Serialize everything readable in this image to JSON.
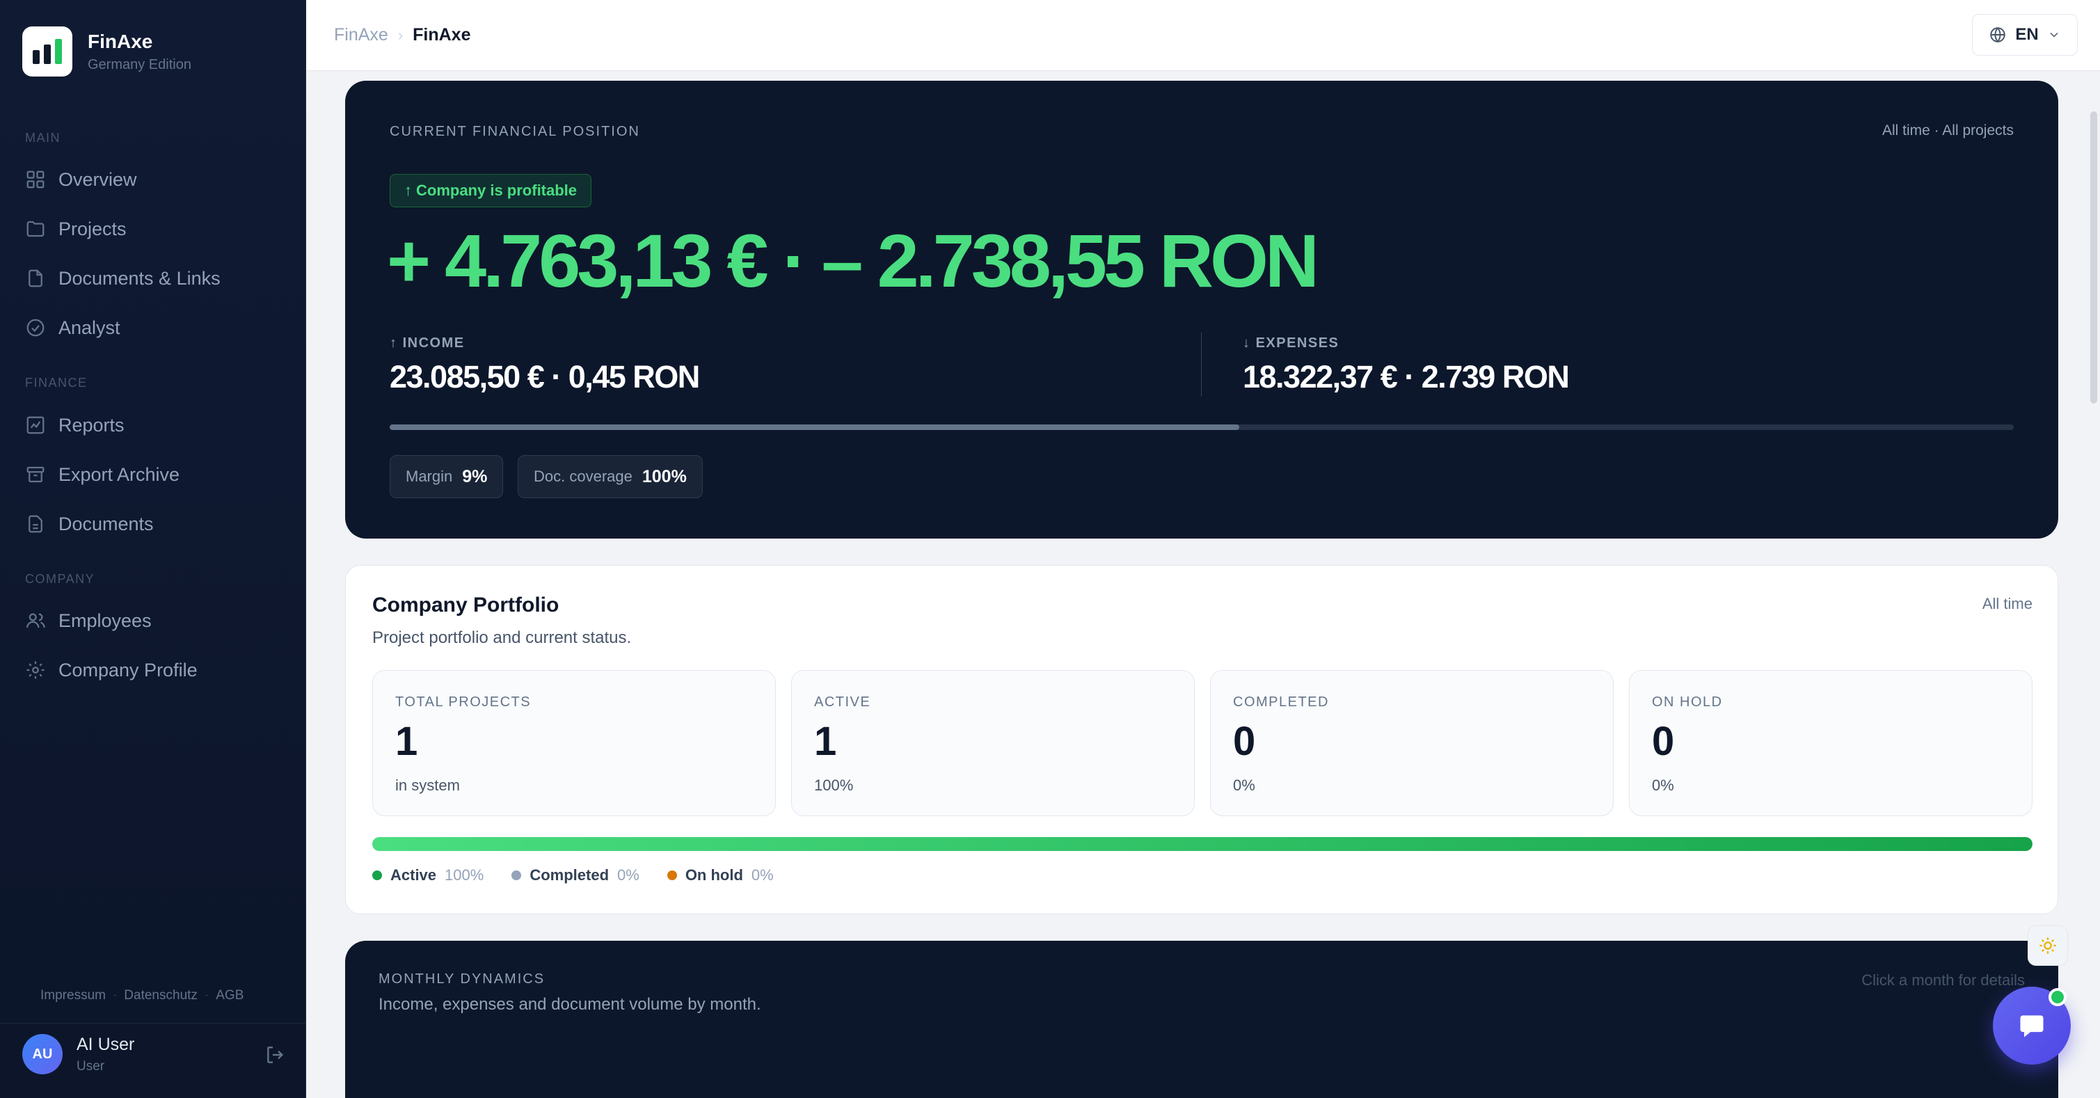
{
  "brand": {
    "name": "FinAxe",
    "edition": "Germany Edition",
    "logo_bar_colors": [
      "#0f172a",
      "#0f172a",
      "#22c55e"
    ]
  },
  "nav": {
    "main_label": "MAIN",
    "main_items": [
      {
        "label": "Overview",
        "icon": "grid-icon"
      },
      {
        "label": "Projects",
        "icon": "folder-icon"
      },
      {
        "label": "Documents & Links",
        "icon": "file-icon"
      },
      {
        "label": "Analyst",
        "icon": "check-circle-icon"
      }
    ],
    "finance_label": "FINANCE",
    "finance_items": [
      {
        "label": "Reports",
        "icon": "chart-icon"
      },
      {
        "label": "Export Archive",
        "icon": "archive-icon"
      },
      {
        "label": "Documents",
        "icon": "document-icon"
      }
    ],
    "company_label": "COMPANY",
    "company_items": [
      {
        "label": "Employees",
        "icon": "users-icon"
      },
      {
        "label": "Company Profile",
        "icon": "gear-icon"
      }
    ]
  },
  "footer": {
    "links": [
      "Impressum",
      "Datenschutz",
      "AGB"
    ]
  },
  "user": {
    "initials": "AU",
    "name": "AI User",
    "role": "User"
  },
  "topbar": {
    "breadcrumb_root": "FinAxe",
    "breadcrumb_current": "FinAxe",
    "language": "EN"
  },
  "financial": {
    "label": "CURRENT FINANCIAL POSITION",
    "scope": "All time · All projects",
    "badge": "Company is profitable",
    "big_value": "+ 4.763,13 € · – 2.738,55 RON",
    "income_label": "INCOME",
    "income_value": "23.085,50 € · 0,45 RON",
    "expenses_label": "EXPENSES",
    "expenses_value": "18.322,37 € · 2.739 RON",
    "income_share": 0.523,
    "margin_label": "Margin",
    "margin_value": "9%",
    "coverage_label": "Doc. coverage",
    "coverage_value": "100%",
    "accent": "#4ade80"
  },
  "portfolio": {
    "title": "Company Portfolio",
    "subtitle": "Project portfolio and current status.",
    "scope": "All time",
    "stats": [
      {
        "label": "TOTAL PROJECTS",
        "value": "1",
        "note": "in system"
      },
      {
        "label": "ACTIVE",
        "value": "1",
        "note": "100%"
      },
      {
        "label": "COMPLETED",
        "value": "0",
        "note": "0%"
      },
      {
        "label": "ON HOLD",
        "value": "0",
        "note": "0%"
      }
    ],
    "active_share": 1.0,
    "legend": [
      {
        "name": "Active",
        "pct": "100%",
        "color": "#16a34a"
      },
      {
        "name": "Completed",
        "pct": "0%",
        "color": "#94a3b8"
      },
      {
        "name": "On hold",
        "pct": "0%",
        "color": "#d97706"
      }
    ]
  },
  "dynamics": {
    "label": "MONTHLY DYNAMICS",
    "subtitle": "Income, expenses and document volume by month.",
    "hint": "Click a month for details"
  }
}
